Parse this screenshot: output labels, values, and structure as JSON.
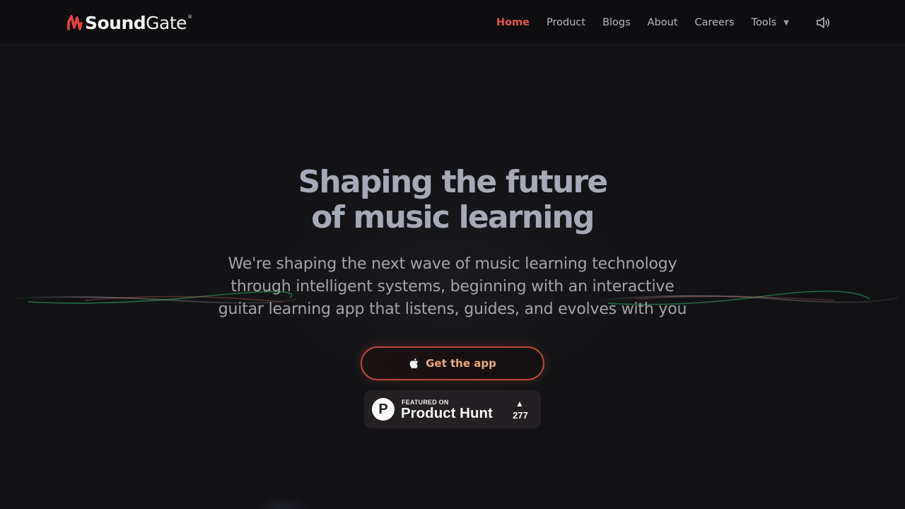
{
  "header": {
    "logo": {
      "sound": "Sound",
      "gate": "Gate",
      "reg": "®",
      "mark_color": "#e2473b"
    },
    "nav": [
      {
        "label": "Home",
        "active": true
      },
      {
        "label": "Product",
        "active": false
      },
      {
        "label": "Blogs",
        "active": false
      },
      {
        "label": "About",
        "active": false
      },
      {
        "label": "Careers",
        "active": false
      },
      {
        "label": "Tools",
        "active": false,
        "dropdown": true
      }
    ],
    "tools_caret": "▼",
    "sound_icon": "speaker-volume-icon"
  },
  "hero": {
    "title_line1": "Shaping the future",
    "title_line2": "of music learning",
    "subtitle_line1": "We're shaping the next wave of music learning technology",
    "subtitle_line2": "through intelligent systems, beginning with an interactive",
    "subtitle_line3": "guitar learning app that listens, guides, and evolves with you"
  },
  "cta": {
    "label": "Get the app",
    "icon": "apple-icon"
  },
  "product_hunt": {
    "featured": "FEATURED ON",
    "name": "Product Hunt",
    "arrow": "▲",
    "count": "277",
    "logo_letter": "P"
  },
  "colors": {
    "accent": "#e2574c",
    "background": "#111114",
    "cta_border": "#b84a3c",
    "cta_text": "#e9a97d"
  }
}
